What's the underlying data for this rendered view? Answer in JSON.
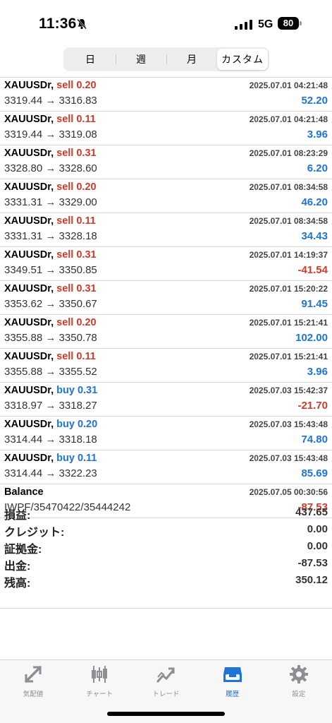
{
  "status_bar": {
    "time": "11:36",
    "network": "5G",
    "battery": "80"
  },
  "segments": [
    {
      "label": "日",
      "active": false
    },
    {
      "label": "週",
      "active": false
    },
    {
      "label": "月",
      "active": false
    },
    {
      "label": "カスタム",
      "active": true
    }
  ],
  "deals": [
    {
      "symbol": "XAUUSDr,",
      "side": "sell",
      "volume": "0.20",
      "date": "2025.07.01 04:21:48",
      "prices": "3319.44 → 3316.83",
      "profit": "52.20"
    },
    {
      "symbol": "XAUUSDr,",
      "side": "sell",
      "volume": "0.11",
      "date": "2025.07.01 04:21:48",
      "prices": "3319.44 → 3319.08",
      "profit": "3.96"
    },
    {
      "symbol": "XAUUSDr,",
      "side": "sell",
      "volume": "0.31",
      "date": "2025.07.01 08:23:29",
      "prices": "3328.80 → 3328.60",
      "profit": "6.20"
    },
    {
      "symbol": "XAUUSDr,",
      "side": "sell",
      "volume": "0.20",
      "date": "2025.07.01 08:34:58",
      "prices": "3331.31 → 3329.00",
      "profit": "46.20"
    },
    {
      "symbol": "XAUUSDr,",
      "side": "sell",
      "volume": "0.11",
      "date": "2025.07.01 08:34:58",
      "prices": "3331.31 → 3328.18",
      "profit": "34.43"
    },
    {
      "symbol": "XAUUSDr,",
      "side": "sell",
      "volume": "0.31",
      "date": "2025.07.01 14:19:37",
      "prices": "3349.51 → 3350.85",
      "profit": "-41.54"
    },
    {
      "symbol": "XAUUSDr,",
      "side": "sell",
      "volume": "0.31",
      "date": "2025.07.01 15:20:22",
      "prices": "3353.62 → 3350.67",
      "profit": "91.45"
    },
    {
      "symbol": "XAUUSDr,",
      "side": "sell",
      "volume": "0.20",
      "date": "2025.07.01 15:21:41",
      "prices": "3355.88 → 3350.78",
      "profit": "102.00"
    },
    {
      "symbol": "XAUUSDr,",
      "side": "sell",
      "volume": "0.11",
      "date": "2025.07.01 15:21:41",
      "prices": "3355.88 → 3355.52",
      "profit": "3.96"
    },
    {
      "symbol": "XAUUSDr,",
      "side": "buy",
      "volume": "0.31",
      "date": "2025.07.03 15:42:37",
      "prices": "3318.97 → 3318.27",
      "profit": "-21.70"
    },
    {
      "symbol": "XAUUSDr,",
      "side": "buy",
      "volume": "0.20",
      "date": "2025.07.03 15:43:48",
      "prices": "3314.44 → 3318.18",
      "profit": "74.80"
    },
    {
      "symbol": "XAUUSDr,",
      "side": "buy",
      "volume": "0.11",
      "date": "2025.07.03 15:43:48",
      "prices": "3314.44 → 3322.23",
      "profit": "85.69"
    }
  ],
  "balance_entry": {
    "title": "Balance",
    "date": "2025.07.05 00:30:56",
    "comment": "IWPF/35470422/35444242",
    "amount": "-87.53"
  },
  "summary": [
    {
      "label": "損益:",
      "value": "437.65"
    },
    {
      "label": "クレジット:",
      "value": "0.00"
    },
    {
      "label": "証拠金:",
      "value": "0.00"
    },
    {
      "label": "出金:",
      "value": "-87.53"
    },
    {
      "label": "残高:",
      "value": "350.12"
    }
  ],
  "tabs": [
    {
      "label": "気配値",
      "icon": "quotes-icon",
      "active": false
    },
    {
      "label": "チャート",
      "icon": "chart-icon",
      "active": false
    },
    {
      "label": "トレード",
      "icon": "trade-icon",
      "active": false
    },
    {
      "label": "履歴",
      "icon": "history-icon",
      "active": true
    },
    {
      "label": "設定",
      "icon": "settings-icon",
      "active": false
    }
  ],
  "colors": {
    "sell": "#d33a2a",
    "buy": "#1e74d9",
    "positive": "#1e74d9",
    "negative": "#d33a2a",
    "tab_active": "#1e74d9",
    "tab_inactive": "#8e8e93"
  }
}
